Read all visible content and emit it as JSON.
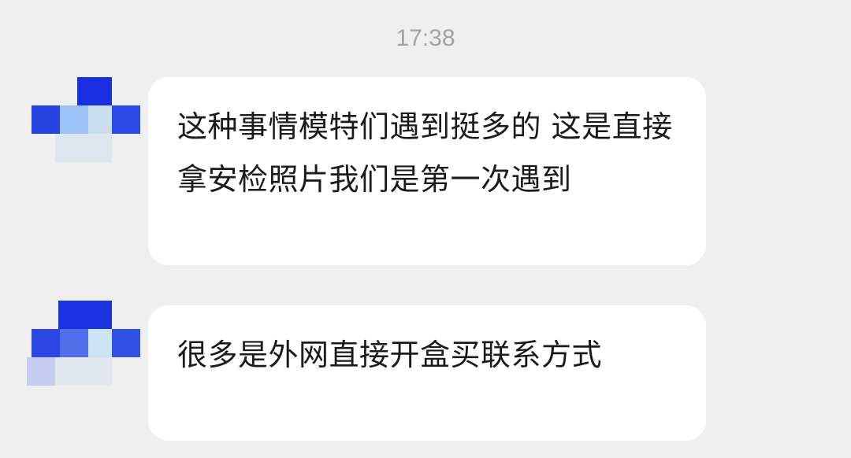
{
  "timestamp": "17:38",
  "messages": [
    {
      "sender": "incoming",
      "text": "这种事情模特们遇到挺多的 这是直接拿安检照片我们是第一次遇到"
    },
    {
      "sender": "incoming",
      "text": "很多是外网直接开盒买联系方式"
    }
  ],
  "colors": {
    "background": "#efefef",
    "bubble": "#ffffff",
    "text": "#1b1b1b",
    "timestamp": "#a3a3a3",
    "avatar_dark_blue": "#1a33e0",
    "avatar_light_blue": "#a8c8f5"
  }
}
